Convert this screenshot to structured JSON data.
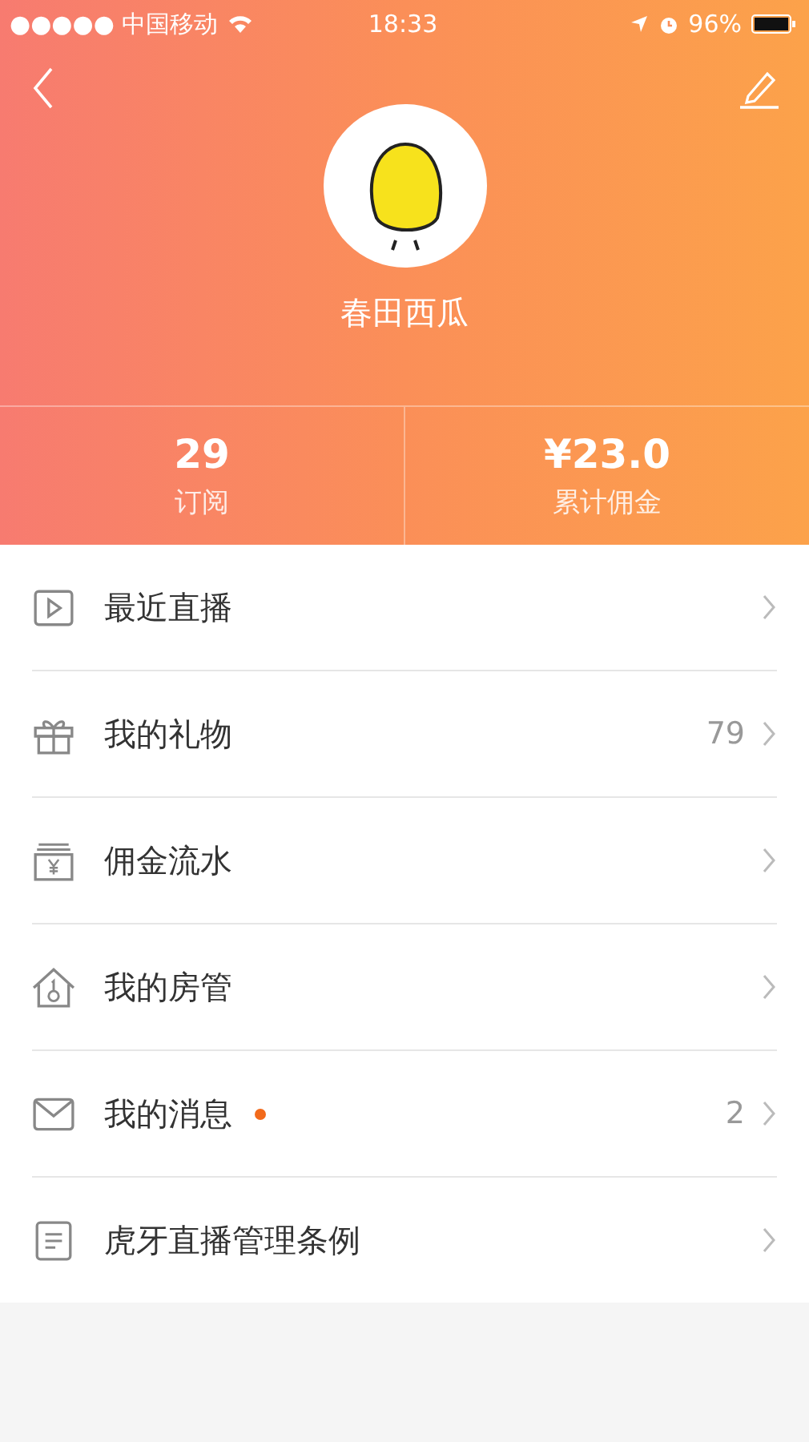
{
  "status_bar": {
    "carrier": "●●●●● 中国移动",
    "time": "18:33",
    "battery": "96%"
  },
  "profile": {
    "name": "春田西瓜"
  },
  "stats": [
    {
      "value": "29",
      "label": "订阅"
    },
    {
      "value": "¥23.0",
      "label": "累计佣金"
    }
  ],
  "menu": [
    {
      "kind": "play",
      "label": "最近直播",
      "unread": false
    },
    {
      "kind": "gift",
      "label": "我的礼物",
      "count": "79",
      "unread": false
    },
    {
      "kind": "wallet",
      "label": "佣金流水",
      "unread": false
    },
    {
      "kind": "house",
      "label": "我的房管",
      "unread": false
    },
    {
      "kind": "mail",
      "label": "我的消息",
      "count": "2",
      "unread": true
    },
    {
      "kind": "doc",
      "label": "虎牙直播管理条例",
      "unread": false
    }
  ]
}
